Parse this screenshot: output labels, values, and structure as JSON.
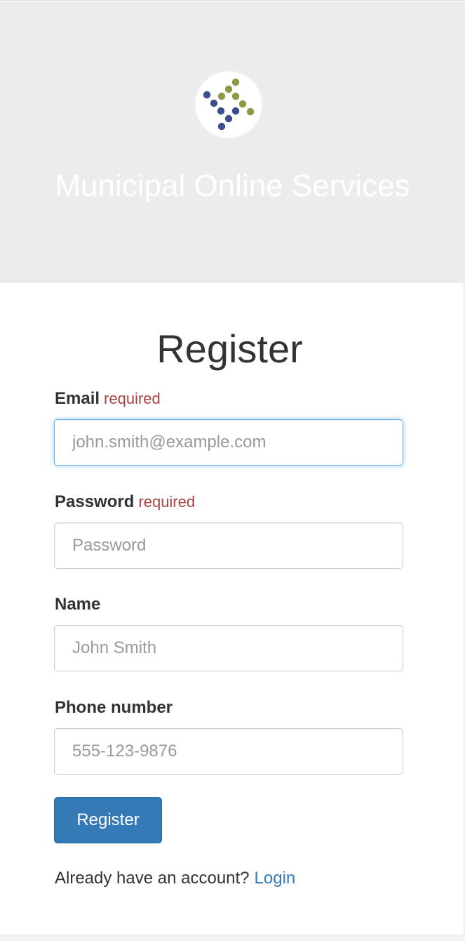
{
  "header": {
    "logo": "municipal-dots-logo",
    "title": "Municipal Online Services"
  },
  "form": {
    "title": "Register",
    "email": {
      "label": "Email",
      "required_text": "required",
      "placeholder": "john.smith@example.com",
      "value": ""
    },
    "password": {
      "label": "Password",
      "required_text": "required",
      "placeholder": "Password",
      "value": ""
    },
    "name": {
      "label": "Name",
      "placeholder": "John Smith",
      "value": ""
    },
    "phone": {
      "label": "Phone number",
      "placeholder": "555-123-9876",
      "value": ""
    },
    "submit_label": "Register",
    "login_prompt": "Already have an account?",
    "login_link": "Login"
  },
  "colors": {
    "header_bg": "#ececec",
    "primary": "#337ab7",
    "required": "#a94442",
    "logo_blue": "#3b4e8c",
    "logo_green": "#8a9a45"
  }
}
